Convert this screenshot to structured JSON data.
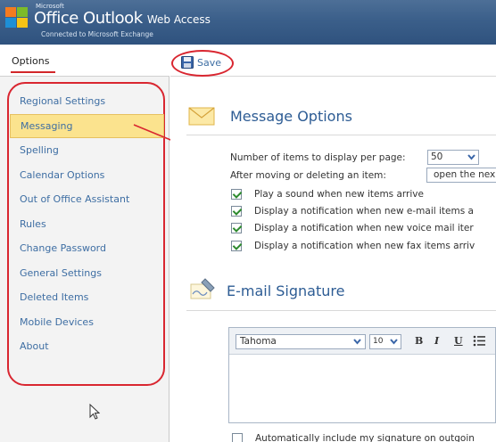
{
  "app": {
    "brand_microsoft": "Microsoft",
    "brand_name": "Office Outlook",
    "brand_suffix": "Web Access",
    "brand_sub": "Connected to Microsoft Exchange"
  },
  "sidebar": {
    "tab_label": "Options",
    "items": [
      {
        "label": "Regional Settings"
      },
      {
        "label": "Messaging",
        "selected": true
      },
      {
        "label": "Spelling"
      },
      {
        "label": "Calendar Options"
      },
      {
        "label": "Out of Office Assistant"
      },
      {
        "label": "Rules"
      },
      {
        "label": "Change Password"
      },
      {
        "label": "General Settings"
      },
      {
        "label": "Deleted Items"
      },
      {
        "label": "Mobile Devices"
      },
      {
        "label": "About"
      }
    ]
  },
  "toolbar": {
    "save_label": "Save"
  },
  "message_options": {
    "title": "Message Options",
    "items_per_page_label": "Number of items to display per page:",
    "items_per_page_value": "50",
    "after_move_label": "After moving or deleting an item:",
    "after_move_value": "open the nex",
    "checks": [
      {
        "label": "Play a sound when new items arrive",
        "checked": true
      },
      {
        "label": "Display a notification when new e-mail items a",
        "checked": true
      },
      {
        "label": "Display a notification when new voice mail iter",
        "checked": true
      },
      {
        "label": "Display a notification when new fax items arriv",
        "checked": true
      }
    ]
  },
  "signature": {
    "title": "E-mail Signature",
    "font_value": "Tahoma",
    "size_value": "10",
    "bold": "B",
    "italic": "I",
    "underline": "U",
    "auto_include_label": "Automatically include my signature on outgoin",
    "auto_include_checked": false
  },
  "colors": {
    "header": "#3b5f8a",
    "link": "#3e6ea3",
    "annotation": "#d92630",
    "selected_bg": "#fbe38e",
    "title": "#2d5c94"
  },
  "icons": [
    "office-logo-icon",
    "save-disk-icon",
    "envelope-icon",
    "signature-pen-icon",
    "dropdown-arrow-icon",
    "mouse-pointer-icon"
  ]
}
